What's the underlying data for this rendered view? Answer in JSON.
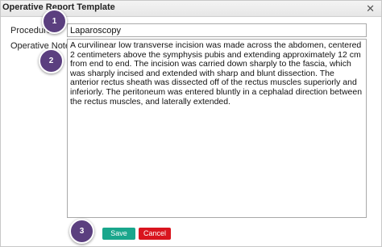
{
  "dialog": {
    "title": "Operative Report Template",
    "close_icon": "close-icon"
  },
  "form": {
    "procedure_label": "Procedure:",
    "procedure_value": "Laparoscopy",
    "note_label": "Operative Note:",
    "note_value": "A curvilinear low transverse incision was made across the abdomen, centered 2 centimeters above the symphysis pubis and extending approximately 12 cm from end to end. The incision was carried down sharply to the fascia, which was sharply incised and extended with sharp and blunt dissection. The anterior rectus sheath was dissected off of the rectus muscles superiorly and inferiorly. The peritoneum was entered bluntly in a cephalad direction between the rectus muscles, and laterally extended."
  },
  "buttons": {
    "save_label": "Save",
    "cancel_label": "Cancel"
  },
  "callouts": [
    "1",
    "2",
    "3"
  ],
  "colors": {
    "save": "#19a68c",
    "cancel": "#d9141e",
    "callout": "#5b3f7f"
  }
}
